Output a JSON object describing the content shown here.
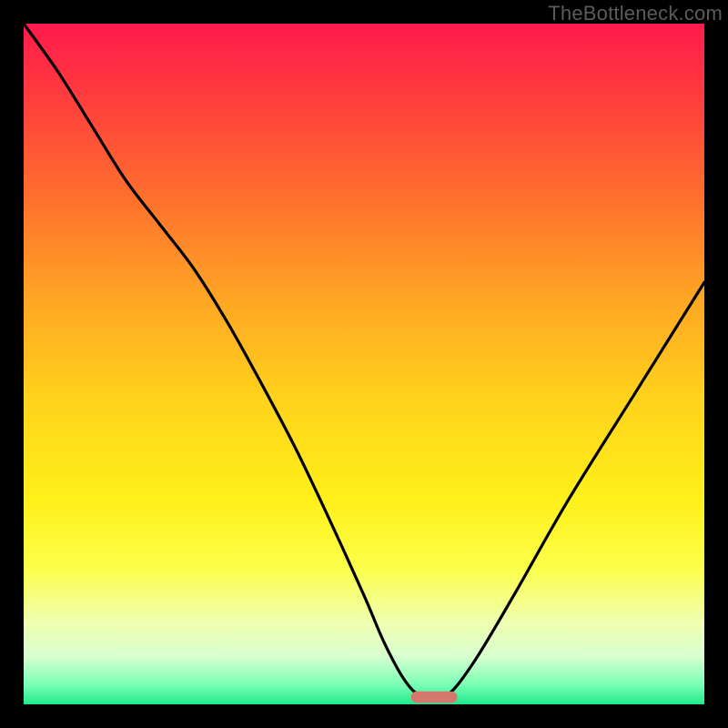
{
  "watermark": "TheBottleneck.com",
  "chart_data": {
    "type": "line",
    "title": "",
    "xlabel": "",
    "ylabel": "",
    "xlim": [
      0,
      100
    ],
    "ylim": [
      0,
      100
    ],
    "background_gradient": {
      "stops": [
        {
          "offset": 0.0,
          "color": "#ff1a4b"
        },
        {
          "offset": 0.1,
          "color": "#ff3a3f"
        },
        {
          "offset": 0.25,
          "color": "#ff6d2e"
        },
        {
          "offset": 0.4,
          "color": "#ffa424"
        },
        {
          "offset": 0.55,
          "color": "#ffd21c"
        },
        {
          "offset": 0.7,
          "color": "#fff01a"
        },
        {
          "offset": 0.8,
          "color": "#fbff4a"
        },
        {
          "offset": 0.88,
          "color": "#f0ffb0"
        },
        {
          "offset": 0.93,
          "color": "#d6ffd0"
        },
        {
          "offset": 0.97,
          "color": "#7dffb6"
        },
        {
          "offset": 1.0,
          "color": "#21e98b"
        }
      ]
    },
    "series": [
      {
        "name": "bottleneck-curve",
        "color": "#000000",
        "x": [
          0,
          5,
          10,
          15,
          20,
          25,
          30,
          35,
          40,
          45,
          50,
          53,
          56,
          58.5,
          62,
          66,
          72,
          80,
          90,
          100
        ],
        "y": [
          100,
          93,
          85,
          77,
          70.5,
          64,
          56,
          47,
          37.5,
          27,
          16,
          9,
          3.5,
          1.2,
          1.2,
          6,
          16,
          30,
          46,
          62
        ]
      }
    ],
    "marker": {
      "name": "min-bar",
      "x_center": 60.3,
      "width": 6.8,
      "height": 1.7,
      "color": "#d4786e",
      "corner_radius": 0.85
    }
  }
}
